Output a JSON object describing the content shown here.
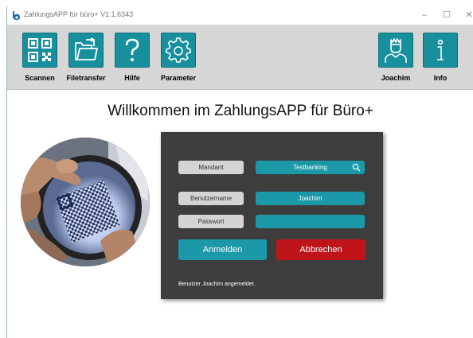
{
  "window": {
    "title": "ZahlungsAPP für büro+ V1.1.6343",
    "min": "–",
    "max": "☐",
    "close": "✕"
  },
  "toolbar": {
    "left": [
      {
        "label": "Scannen",
        "icon": "qr-code-icon"
      },
      {
        "label": "Filetransfer",
        "icon": "folder-transfer-icon"
      },
      {
        "label": "Hilfe",
        "icon": "question-mark-icon"
      },
      {
        "label": "Parameter",
        "icon": "gear-icon"
      }
    ],
    "right": [
      {
        "label": "Joachim",
        "icon": "user-icon"
      },
      {
        "label": "Info",
        "icon": "info-icon"
      }
    ]
  },
  "welcome": "Willkommen im ZahlungsAPP für Büro+",
  "login": {
    "mandant_label": "Mandant",
    "mandant_value": "Testbanking",
    "user_label": "Benutzername",
    "user_value": "Joachim",
    "password_label": "Passwort",
    "password_value": "",
    "login_button": "Anmelden",
    "cancel_button": "Abbrechen",
    "status": "Benutzer Joachim angemeldet."
  },
  "colors": {
    "accent": "#178f9c",
    "cancel": "#c0141b",
    "panel": "#3d3d3d",
    "toolbar": "#d6d6d6"
  }
}
